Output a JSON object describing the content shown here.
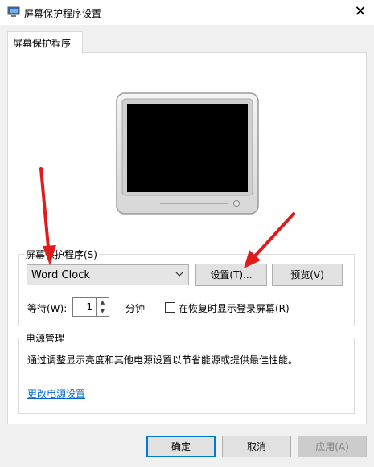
{
  "window": {
    "title": "屏幕保护程序设置",
    "close_glyph": "✕"
  },
  "tabs": [
    {
      "label": "屏幕保护程序"
    }
  ],
  "screensaver_group": {
    "legend": "屏幕保护程序(S)",
    "selected": "Word Clock",
    "settings_button": "设置(T)...",
    "preview_button": "预览(V)",
    "wait_label": "等待(W):",
    "wait_value": "1",
    "wait_unit": "分钟",
    "resume_checkbox_label": "在恢复时显示登录屏幕(R)",
    "resume_checked": false
  },
  "power_group": {
    "legend": "电源管理",
    "description": "通过调整显示亮度和其他电源设置以节省能源或提供最佳性能。",
    "link": "更改电源设置"
  },
  "footer": {
    "ok": "确定",
    "cancel": "取消",
    "apply": "应用(A)",
    "apply_enabled": false
  },
  "colors": {
    "annotation_arrow": "#e01b1b",
    "link": "#0066cc",
    "primary_border": "#0078d7"
  }
}
